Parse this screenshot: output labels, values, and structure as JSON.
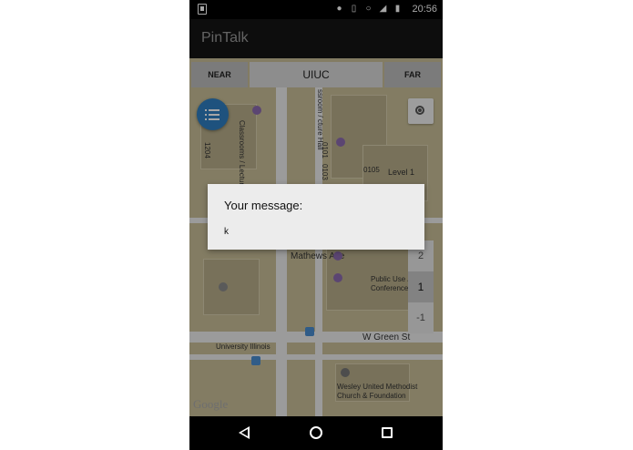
{
  "status_bar": {
    "time": "20:56",
    "icons": [
      "location-icon",
      "vibrate-icon",
      "alarm-icon",
      "signal-icon",
      "battery-icon"
    ]
  },
  "app": {
    "title": "PinTalk"
  },
  "search": {
    "near_label": "NEAR",
    "location_value": "UIUC",
    "far_label": "FAR"
  },
  "map": {
    "labels": {
      "classrooms": "Classrooms / Lecture Halls",
      "classroom_hall": "ssroom / cture Hall",
      "room_1204": "1204",
      "room_0101": "0101",
      "room_0103": "0103",
      "room_0105": "0105",
      "level": "Level 1",
      "public_use": "Public Use / Conference",
      "mathews_ave": "Mathews Ave",
      "w_green_st": "W Green St",
      "university_illinois": "University Illinois",
      "wesley": "Wesley United Methodist Church & Foundation"
    },
    "floors": [
      "2",
      "1",
      "-1"
    ],
    "active_floor": "1",
    "google": "Google"
  },
  "dialog": {
    "title": "Your message:",
    "message": "k"
  }
}
